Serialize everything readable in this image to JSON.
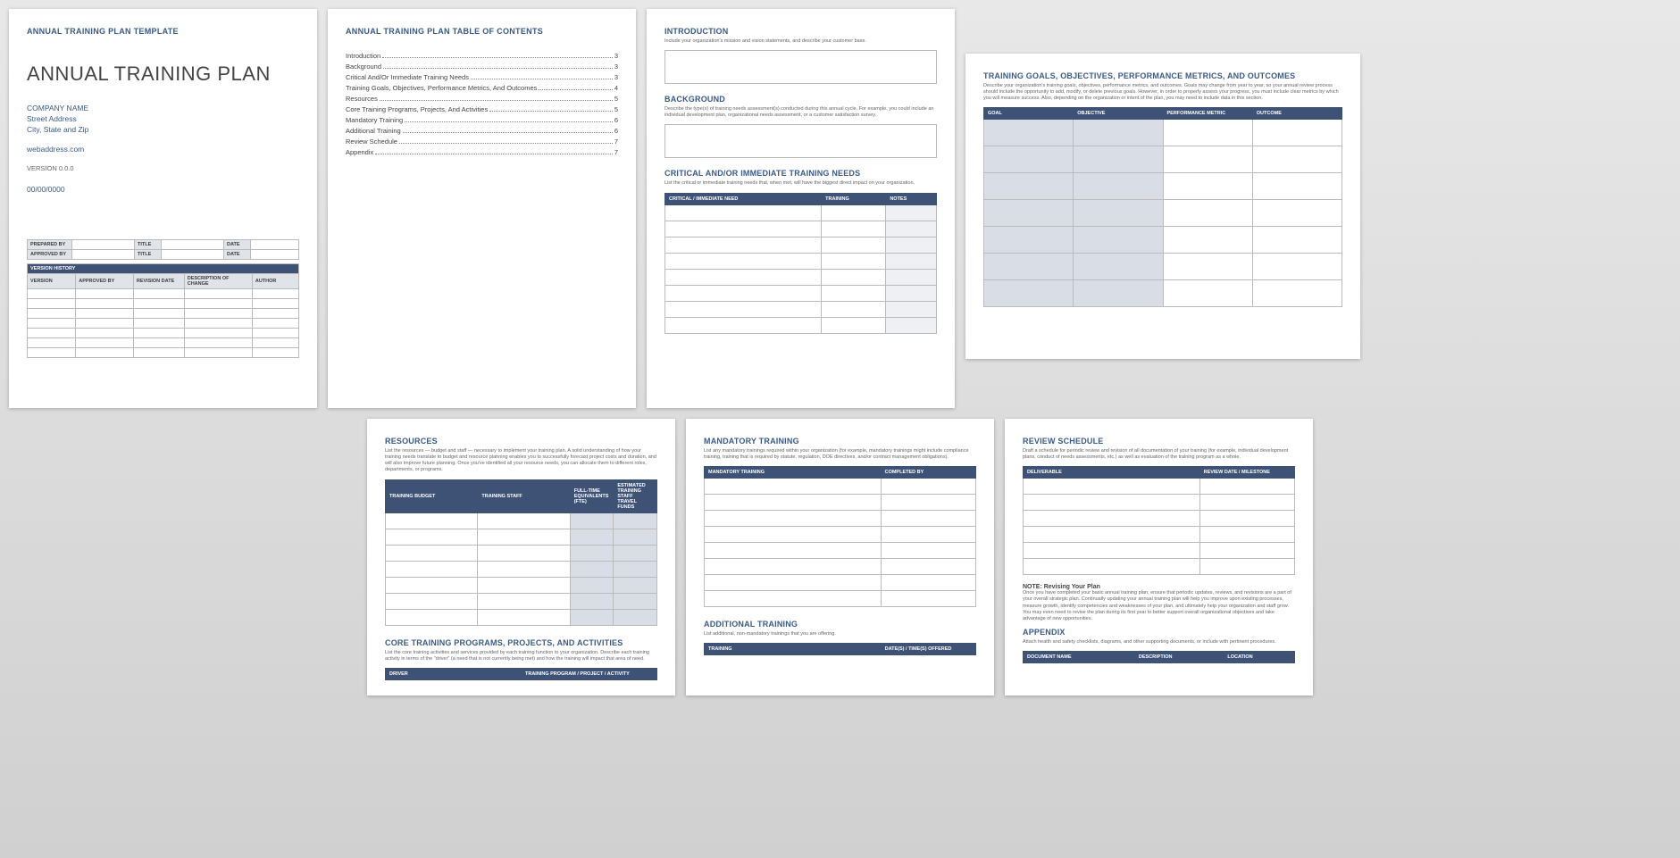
{
  "page1": {
    "header": "ANNUAL TRAINING PLAN TEMPLATE",
    "title": "ANNUAL TRAINING PLAN",
    "company": "COMPANY NAME",
    "street": "Street Address",
    "city": "City, State and Zip",
    "web": "webaddress.com",
    "version": "VERSION 0.0.0",
    "date": "00/00/0000",
    "prepared_by": "PREPARED BY",
    "approved_by": "APPROVED BY",
    "title_lbl": "TITLE",
    "date_lbl": "DATE",
    "version_history": "VERSION HISTORY",
    "vh_cols": [
      "VERSION",
      "APPROVED BY",
      "REVISION DATE",
      "DESCRIPTION OF CHANGE",
      "AUTHOR"
    ]
  },
  "page2": {
    "header": "ANNUAL TRAINING PLAN TABLE OF CONTENTS",
    "items": [
      {
        "t": "Introduction",
        "p": "3"
      },
      {
        "t": "Background",
        "p": "3"
      },
      {
        "t": "Critical And/Or Immediate Training Needs",
        "p": "3"
      },
      {
        "t": "Training Goals, Objectives, Performance Metrics, And Outcomes",
        "p": "4"
      },
      {
        "t": "Resources",
        "p": "5"
      },
      {
        "t": "Core Training Programs, Projects, And Activities",
        "p": "5"
      },
      {
        "t": "Mandatory Training",
        "p": "6"
      },
      {
        "t": "Additional Training",
        "p": "6"
      },
      {
        "t": "Review Schedule",
        "p": "7"
      },
      {
        "t": "Appendix",
        "p": "7"
      }
    ]
  },
  "page3": {
    "intro_title": "INTRODUCTION",
    "intro_desc": "Include your organization's mission and vision statements, and describe your customer base.",
    "bg_title": "BACKGROUND",
    "bg_desc": "Describe the type(s) of training needs assessment(s) conducted during this annual cycle. For example, you could include an individual development plan, organizational needs assessment, or a customer satisfaction survey.",
    "crit_title": "CRITICAL AND/OR IMMEDIATE TRAINING NEEDS",
    "crit_desc": "List the critical or immediate training needs that, when met, will have the biggest direct impact on your organization.",
    "crit_cols": [
      "CRITICAL / IMMEDIATE NEED",
      "TRAINING",
      "NOTES"
    ]
  },
  "page4": {
    "title": "TRAINING GOALS, OBJECTIVES, PERFORMANCE METRICS, AND OUTCOMES",
    "desc": "Describe your organization's training goals, objectives, performance metrics, and outcomes. Goals may change from year to year, so your annual review process should include the opportunity to add, modify, or delete previous goals. However, in order to properly assess your progress, you must include clear metrics by which you will measure success. Also, depending on the organization or intent of the plan, you may need to include data in this section.",
    "cols": [
      "GOAL",
      "OBJECTIVE",
      "PERFORMANCE METRIC",
      "OUTCOME"
    ]
  },
  "page5": {
    "res_title": "RESOURCES",
    "res_desc": "List the resources — budget and staff — necessary to implement your training plan. A solid understanding of how your training needs translate to budget and resource planning enables you to successfully forecast project costs and duration, and will also improve future planning. Once you've identified all your resource needs, you can allocate them to different roles, departments, or programs.",
    "res_cols": [
      "TRAINING BUDGET",
      "TRAINING STAFF",
      "FULL-TIME EQUIVALENTS (FTE)",
      "ESTIMATED TRAINING STAFF TRAVEL FUNDS"
    ],
    "core_title": "CORE TRAINING PROGRAMS, PROJECTS, AND ACTIVITIES",
    "core_desc": "List the core training activities and services provided by each training function to your organization. Describe each training activity in terms of the \"driver\" (a need that is not currently being met) and how the training will impact that area of need.",
    "core_cols": [
      "DRIVER",
      "TRAINING PROGRAM / PROJECT / ACTIVITY"
    ]
  },
  "page6": {
    "mand_title": "MANDATORY TRAINING",
    "mand_desc": "List any mandatory trainings required within your organization (for example, mandatory trainings might include compliance training, training that is required by statute, regulation, DOE directives, and/or contract management obligations).",
    "mand_cols": [
      "MANDATORY TRAINING",
      "COMPLETED BY"
    ],
    "add_title": "ADDITIONAL TRAINING",
    "add_desc": "List additional, non-mandatory trainings that you are offering.",
    "add_cols": [
      "TRAINING",
      "DATE(S) / TIME(S) OFFERED"
    ]
  },
  "page7": {
    "rev_title": "REVIEW SCHEDULE",
    "rev_desc": "Draft a schedule for periodic review and revision of all documentation of your training (for example, individual development plans, conduct of needs assessments, etc.) as well as evaluation of the training program as a whole.",
    "rev_cols": [
      "DELIVERABLE",
      "REVIEW DATE / MILESTONE"
    ],
    "note_title": "NOTE: Revising Your Plan",
    "note_desc": "Once you have completed your basic annual training plan, ensure that periodic updates, reviews, and revisions are a part of your overall strategic plan. Continually updating your annual training plan will help you improve upon existing processes, measure growth, identify competencies and weaknesses of your plan, and ultimately help your organization and staff grow. You may even need to revise the plan during its first year to better support overall organizational objectives and take advantage of new opportunities.",
    "app_title": "APPENDIX",
    "app_desc": "Attach health and safety checklists, diagrams, and other supporting documents, or include with pertinent procedures.",
    "app_cols": [
      "DOCUMENT NAME",
      "DESCRIPTION",
      "LOCATION"
    ]
  }
}
